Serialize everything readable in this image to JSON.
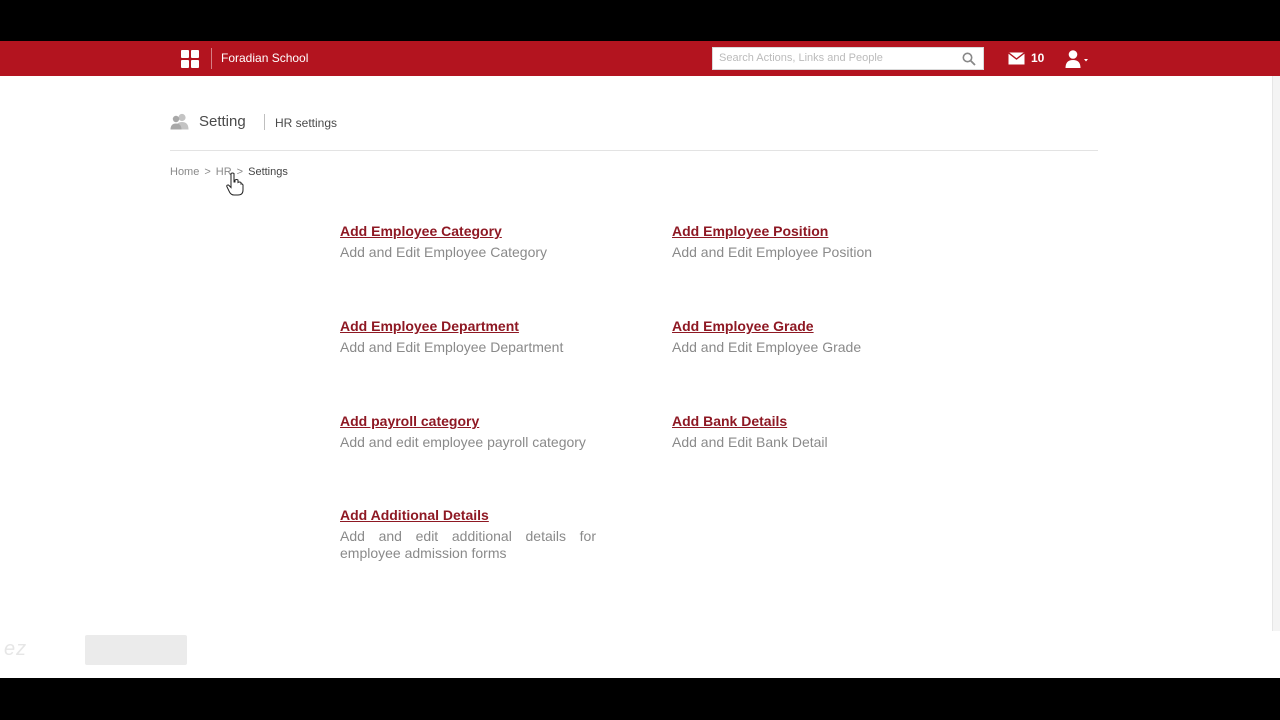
{
  "topbar": {
    "app_name": "Foradian School",
    "search_placeholder": "Search Actions, Links and People",
    "mail_count": "10",
    "brand_color": "#b3141f",
    "icons": [
      "apps-grid-icon",
      "search-icon",
      "mail-icon",
      "user-icon",
      "caret-down-icon"
    ]
  },
  "header": {
    "title": "Setting",
    "subtitle": "HR settings"
  },
  "breadcrumb": {
    "home": "Home",
    "sep1": ">",
    "hr": "HR",
    "sep2": ">",
    "current": "Settings"
  },
  "settings": [
    {
      "title": "Add Employee Category",
      "desc": "Add and Edit Employee Category"
    },
    {
      "title": "Add Employee Position",
      "desc": "Add and Edit Employee Position"
    },
    {
      "title": "Add Employee Department",
      "desc": "Add and Edit Employee Department"
    },
    {
      "title": "Add Employee Grade",
      "desc": "Add and Edit Employee Grade"
    },
    {
      "title": "Add payroll category",
      "desc": "Add and edit employee payroll category"
    },
    {
      "title": "Add Bank Details",
      "desc": "Add and Edit Bank Detail"
    },
    {
      "title": "Add Additional Details",
      "desc": "Add and edit additional details for employee admission forms"
    }
  ],
  "colors": {
    "link": "#8e1823",
    "description": "#8a8a8a"
  }
}
